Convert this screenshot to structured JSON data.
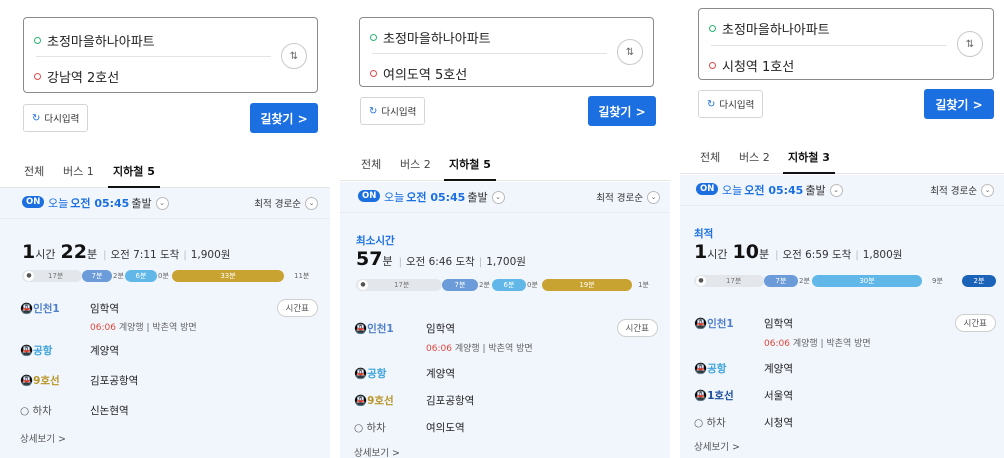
{
  "panels": [
    {
      "origin": "초정마을하나아파트",
      "destination": "강남역 2호선",
      "reset_label": "다시입력",
      "search_label": "길찾기 >",
      "tabs": [
        "전체",
        "버스 1",
        "지하철 5"
      ],
      "active_tab": 2,
      "on_badge": "ON",
      "depart_today": "오늘",
      "depart_time": "오전 05:45",
      "depart_suffix": "출발",
      "sort_label": "최적 경로순",
      "route_label": "",
      "duration_hours": "1",
      "duration_hours_unit": "시간",
      "duration_minutes": "22",
      "duration_minutes_unit": "분",
      "arrival": "오전 7:11 도착",
      "fare": "1,900원",
      "segments": [
        {
          "type": "walk",
          "label": "17분"
        },
        {
          "type": "incheon",
          "label": "7분"
        },
        {
          "type": "walk",
          "label": "2분"
        },
        {
          "type": "airport",
          "label": "6분"
        },
        {
          "type": "walk",
          "label": "0분"
        },
        {
          "type": "line9",
          "label": "33분"
        },
        {
          "type": "walk",
          "label": "11분"
        }
      ],
      "steps": [
        {
          "line": "인천1",
          "kind": "incheon",
          "station": "임학역",
          "time": "06:06",
          "sub": "계양행 | 박촌역 방면",
          "timetable": "시간표"
        },
        {
          "line": "공항",
          "kind": "airport",
          "station": "계양역"
        },
        {
          "line": "9호선",
          "kind": "line9",
          "station": "김포공항역"
        },
        {
          "line": "하차",
          "kind": "exit",
          "station": "신논현역"
        }
      ],
      "detail_label": "상세보기 >"
    },
    {
      "origin": "초정마을하나아파트",
      "destination": "여의도역 5호선",
      "reset_label": "다시입력",
      "search_label": "길찾기 >",
      "tabs": [
        "전체",
        "버스 2",
        "지하철 5"
      ],
      "active_tab": 2,
      "on_badge": "ON",
      "depart_today": "오늘",
      "depart_time": "오전 05:45",
      "depart_suffix": "출발",
      "sort_label": "최적 경로순",
      "route_label": "최소시간",
      "duration_hours": "",
      "duration_hours_unit": "",
      "duration_minutes": "57",
      "duration_minutes_unit": "분",
      "arrival": "오전 6:46 도착",
      "fare": "1,700원",
      "segments": [
        {
          "type": "walk",
          "label": "17분"
        },
        {
          "type": "incheon",
          "label": "7분"
        },
        {
          "type": "walk",
          "label": "2분"
        },
        {
          "type": "airport",
          "label": "6분"
        },
        {
          "type": "walk",
          "label": "0분"
        },
        {
          "type": "line9",
          "label": "19분"
        },
        {
          "type": "walk",
          "label": "1분"
        }
      ],
      "steps": [
        {
          "line": "인천1",
          "kind": "incheon",
          "station": "임학역",
          "time": "06:06",
          "sub": "계양행 | 박촌역 방면",
          "timetable": "시간표"
        },
        {
          "line": "공항",
          "kind": "airport",
          "station": "계양역"
        },
        {
          "line": "9호선",
          "kind": "line9",
          "station": "김포공항역"
        },
        {
          "line": "하차",
          "kind": "exit",
          "station": "여의도역"
        }
      ],
      "detail_label": "상세보기 >"
    },
    {
      "origin": "초정마을하나아파트",
      "destination": "시청역 1호선",
      "reset_label": "다시입력",
      "search_label": "길찾기 >",
      "tabs": [
        "전체",
        "버스 2",
        "지하철 3"
      ],
      "active_tab": 2,
      "on_badge": "ON",
      "depart_today": "오늘",
      "depart_time": "오전 05:45",
      "depart_suffix": "출발",
      "sort_label": "최적 경로순",
      "route_label": "최적",
      "duration_hours": "1",
      "duration_hours_unit": "시간",
      "duration_minutes": "10",
      "duration_minutes_unit": "분",
      "arrival": "오전 6:59 도착",
      "fare": "1,800원",
      "segments": [
        {
          "type": "walk",
          "label": "17분"
        },
        {
          "type": "incheon",
          "label": "7분"
        },
        {
          "type": "walk",
          "label": "2분"
        },
        {
          "type": "airport",
          "label": "30분"
        },
        {
          "type": "walk",
          "label": "9분"
        },
        {
          "type": "line1",
          "label": "2분"
        }
      ],
      "steps": [
        {
          "line": "인천1",
          "kind": "incheon",
          "station": "임학역",
          "time": "06:06",
          "sub": "계양행 | 박촌역 방면",
          "timetable": "시간표"
        },
        {
          "line": "공항",
          "kind": "airport",
          "station": "계양역"
        },
        {
          "line": "1호선",
          "kind": "line1",
          "station": "서울역"
        },
        {
          "line": "하차",
          "kind": "exit",
          "station": "시청역"
        }
      ],
      "detail_label": "상세보기 >"
    }
  ],
  "colors": {
    "accent": "#1b6fe0",
    "incheon1": "#6b9bd8",
    "airport": "#61b8e8",
    "line9": "#c8a331",
    "line1": "#1b63b8"
  }
}
